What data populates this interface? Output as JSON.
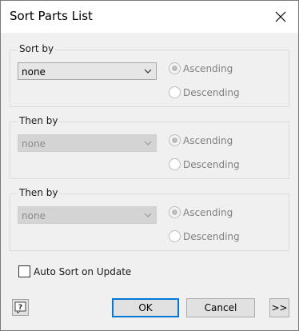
{
  "window": {
    "title": "Sort Parts List"
  },
  "groups": [
    {
      "label": "Sort by",
      "select_value": "none",
      "enabled": true,
      "radios": [
        {
          "label": "Ascending",
          "checked": true
        },
        {
          "label": "Descending",
          "checked": false
        }
      ]
    },
    {
      "label": "Then by",
      "select_value": "none",
      "enabled": false,
      "radios": [
        {
          "label": "Ascending",
          "checked": true
        },
        {
          "label": "Descending",
          "checked": false
        }
      ]
    },
    {
      "label": "Then by",
      "select_value": "none",
      "enabled": false,
      "radios": [
        {
          "label": "Ascending",
          "checked": true
        },
        {
          "label": "Descending",
          "checked": false
        }
      ]
    }
  ],
  "auto_sort": {
    "label": "Auto Sort on Update",
    "checked": false
  },
  "buttons": {
    "help_glyph": "?",
    "ok": "OK",
    "cancel": "Cancel",
    "more": ">>"
  },
  "colors": {
    "accent": "#0078d7",
    "dialog_bg": "#f0f0f0"
  }
}
